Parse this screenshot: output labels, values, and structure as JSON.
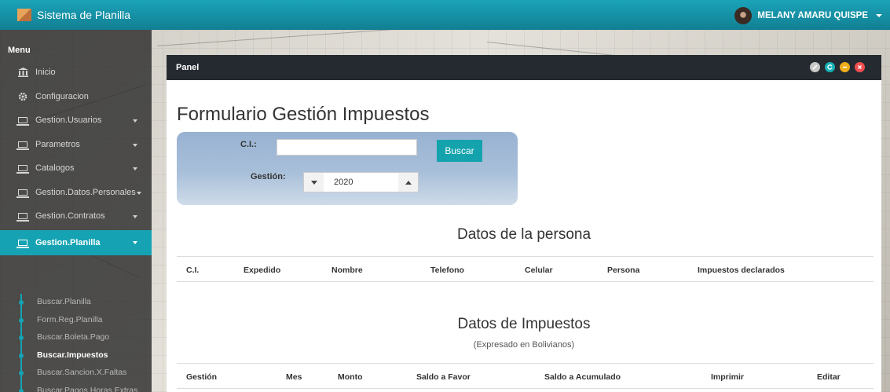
{
  "app": {
    "title": "Sistema de Planilla"
  },
  "user": {
    "name": "MELANY AMARU QUISPE"
  },
  "sidebar": {
    "menu_title": "Menu",
    "items": [
      {
        "label": "Inicio",
        "icon": "bank-icon",
        "has_children": false,
        "active": false
      },
      {
        "label": "Configuracion",
        "icon": "gear-icon",
        "has_children": false,
        "active": false
      },
      {
        "label": "Gestion.Usuarios",
        "icon": "laptop-icon",
        "has_children": true,
        "active": false
      },
      {
        "label": "Parametros",
        "icon": "laptop-icon",
        "has_children": true,
        "active": false
      },
      {
        "label": "Catalogos",
        "icon": "laptop-icon",
        "has_children": true,
        "active": false
      },
      {
        "label": "Gestion.Datos.Personales",
        "icon": "laptop-icon",
        "has_children": true,
        "active": false
      },
      {
        "label": "Gestion.Contratos",
        "icon": "laptop-icon",
        "has_children": true,
        "active": false
      },
      {
        "label": "Gestion.Planilla",
        "icon": "laptop-icon",
        "has_children": true,
        "active": true
      }
    ],
    "subitems": [
      {
        "label": "Buscar.Planilla",
        "active": false
      },
      {
        "label": "Form.Reg.Planilla",
        "active": false
      },
      {
        "label": "Buscar.Boleta.Pago",
        "active": false
      },
      {
        "label": "Buscar.Impuestos",
        "active": true
      },
      {
        "label": "Buscar.Sancion.X.Faltas",
        "active": false
      },
      {
        "label": "Buscar.Pagos.Horas.Extras",
        "active": false
      }
    ]
  },
  "panel": {
    "title": "Panel",
    "controls": [
      "settings-icon",
      "refresh-icon",
      "minimize-icon",
      "close-icon"
    ],
    "colors": {
      "settings": "#c8c8c8",
      "refresh": "#17b1b4",
      "minimize": "#f0ad1c",
      "close": "#f04e4e"
    }
  },
  "form": {
    "title": "Formulario Gestión Impuestos",
    "ci_label": "C.I.:",
    "ci_value": "",
    "search_button": "Buscar",
    "gestion_label": "Gestión:",
    "gestion_value": "2020"
  },
  "persona": {
    "title": "Datos de la persona",
    "columns": [
      "C.I.",
      "Expedido",
      "Nombre",
      "Telefono",
      "Celular",
      "Persona",
      "Impuestos declarados"
    ]
  },
  "impuestos": {
    "title": "Datos de Impuestos",
    "subtitle": "(Expresado en Bolivianos)",
    "columns": [
      "Gestión",
      "Mes",
      "Monto",
      "Saldo a Favor",
      "Saldo a Acumulado",
      "Imprimir",
      "Editar"
    ]
  },
  "colors": {
    "topbar": "#1aa3b8",
    "accent": "#15a3b3",
    "panel_header": "#252a30",
    "button": "#14a3ad"
  }
}
